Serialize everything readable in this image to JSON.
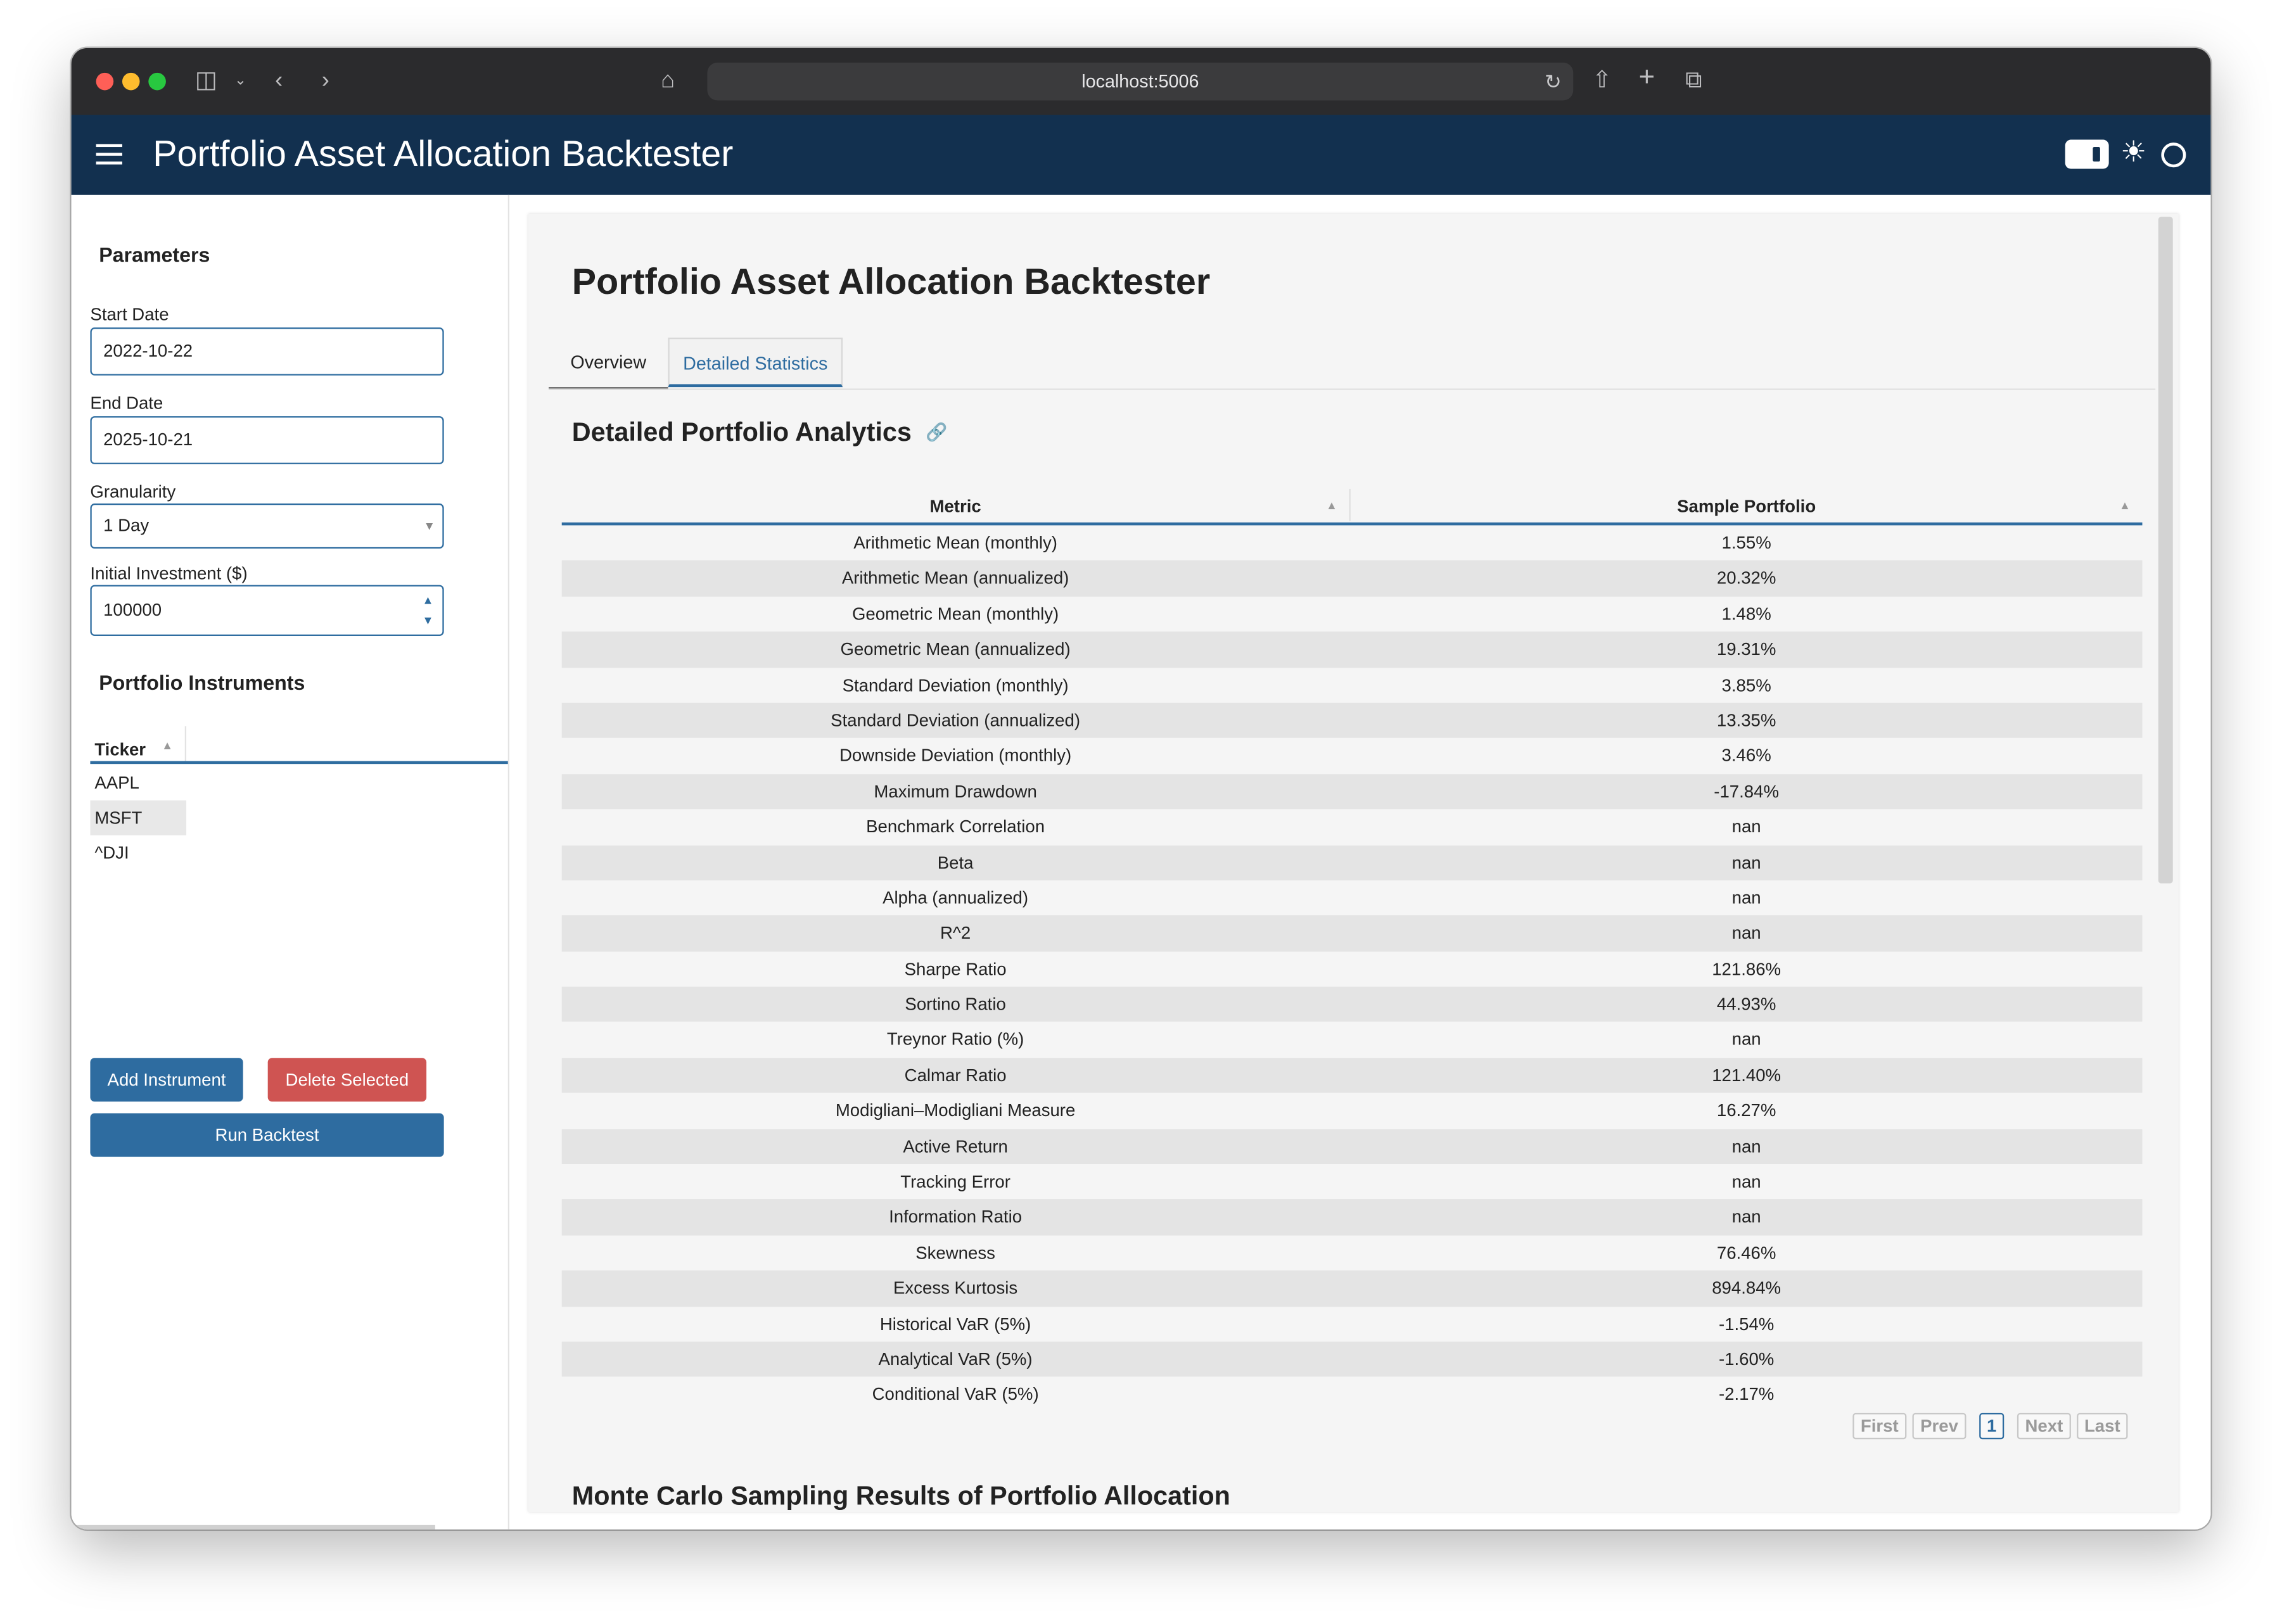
{
  "browser": {
    "url": "localhost:5006"
  },
  "app": {
    "title": "Portfolio Asset Allocation Backtester"
  },
  "sidebar": {
    "parameters_heading": "Parameters",
    "start_date_label": "Start Date",
    "start_date_value": "2022-10-22",
    "end_date_label": "End Date",
    "end_date_value": "2025-10-21",
    "granularity_label": "Granularity",
    "granularity_value": "1 Day",
    "investment_label": "Initial Investment ($)",
    "investment_value": "100000",
    "instruments_heading": "Portfolio Instruments",
    "ticker_header": "Ticker",
    "tickers": [
      "AAPL",
      "MSFT",
      "^DJI"
    ],
    "add_button": "Add Instrument",
    "delete_button": "Delete Selected",
    "run_button": "Run Backtest"
  },
  "main": {
    "page_title": "Portfolio Asset Allocation Backtester",
    "tabs": [
      {
        "label": "Overview",
        "active": false
      },
      {
        "label": "Detailed Statistics",
        "active": true
      }
    ],
    "section_title": "Detailed Portfolio Analytics",
    "table": {
      "headers": [
        "Metric",
        "Sample Portfolio"
      ],
      "rows": [
        [
          "Arithmetic Mean (monthly)",
          "1.55%"
        ],
        [
          "Arithmetic Mean (annualized)",
          "20.32%"
        ],
        [
          "Geometric Mean (monthly)",
          "1.48%"
        ],
        [
          "Geometric Mean (annualized)",
          "19.31%"
        ],
        [
          "Standard Deviation (monthly)",
          "3.85%"
        ],
        [
          "Standard Deviation (annualized)",
          "13.35%"
        ],
        [
          "Downside Deviation (monthly)",
          "3.46%"
        ],
        [
          "Maximum Drawdown",
          "-17.84%"
        ],
        [
          "Benchmark Correlation",
          "nan"
        ],
        [
          "Beta",
          "nan"
        ],
        [
          "Alpha (annualized)",
          "nan"
        ],
        [
          "R^2",
          "nan"
        ],
        [
          "Sharpe Ratio",
          "121.86%"
        ],
        [
          "Sortino Ratio",
          "44.93%"
        ],
        [
          "Treynor Ratio (%)",
          "nan"
        ],
        [
          "Calmar Ratio",
          "121.40%"
        ],
        [
          "Modigliani–Modigliani Measure",
          "16.27%"
        ],
        [
          "Active Return",
          "nan"
        ],
        [
          "Tracking Error",
          "nan"
        ],
        [
          "Information Ratio",
          "nan"
        ],
        [
          "Skewness",
          "76.46%"
        ],
        [
          "Excess Kurtosis",
          "894.84%"
        ],
        [
          "Historical VaR (5%)",
          "-1.54%"
        ],
        [
          "Analytical VaR (5%)",
          "-1.60%"
        ],
        [
          "Conditional VaR (5%)",
          "-2.17%"
        ]
      ]
    },
    "pager": {
      "first": "First",
      "prev": "Prev",
      "page": "1",
      "next": "Next",
      "last": "Last"
    },
    "monte_carlo_title": "Monte Carlo Sampling Results of Portfolio Allocation"
  },
  "colors": {
    "header_bg": "#12304f",
    "accent": "#2e6ca0",
    "danger": "#cf5452"
  }
}
